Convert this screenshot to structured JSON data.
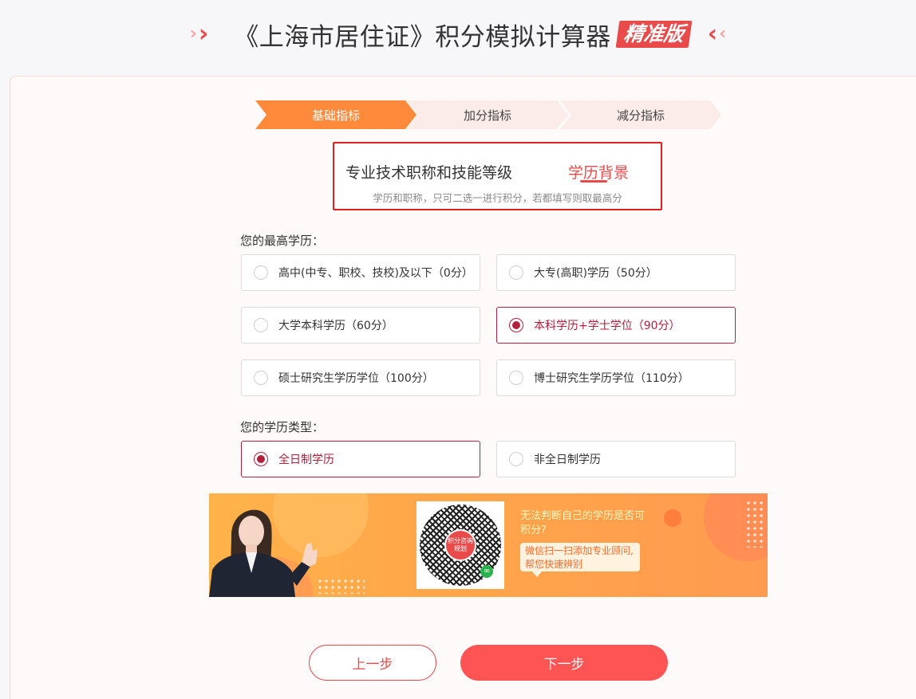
{
  "header": {
    "title": "《上海市居住证》积分模拟计算器",
    "badge": "精准版"
  },
  "steps": [
    {
      "label": "基础指标",
      "active": true
    },
    {
      "label": "加分指标",
      "active": false
    },
    {
      "label": "减分指标",
      "active": false
    }
  ],
  "tabs": {
    "title_tab": "专业技术职称和技能等级",
    "edu_tab": "学历背景",
    "hint": "学历和职称，只可二选一进行积分，若都填写则取最高分"
  },
  "education": {
    "label": "您的最高学历：",
    "options": [
      {
        "label": "高中(中专、职校、技校)及以下（0分）",
        "selected": false
      },
      {
        "label": "大专(高职)学历（50分）",
        "selected": false
      },
      {
        "label": "大学本科学历（60分）",
        "selected": false
      },
      {
        "label": "本科学历+学士学位（90分）",
        "selected": true
      },
      {
        "label": "硕士研究生学历学位（100分）",
        "selected": false
      },
      {
        "label": "博士研究生学历学位（110分）",
        "selected": false
      }
    ]
  },
  "edu_type": {
    "label": "您的学历类型：",
    "options": [
      {
        "label": "全日制学历",
        "selected": true
      },
      {
        "label": "非全日制学历",
        "selected": false
      }
    ]
  },
  "banner": {
    "question": "无法判断自己的学历是否可积分?",
    "bubble": "微信扫一扫添加专业顾问,帮您快速辨别",
    "qr_center": "积分咨询规划"
  },
  "buttons": {
    "prev": "上一步",
    "next": "下一步"
  },
  "colors": {
    "accent": "#e94a4a",
    "step_active": "#ff8a3b",
    "selected": "#b3203b"
  }
}
